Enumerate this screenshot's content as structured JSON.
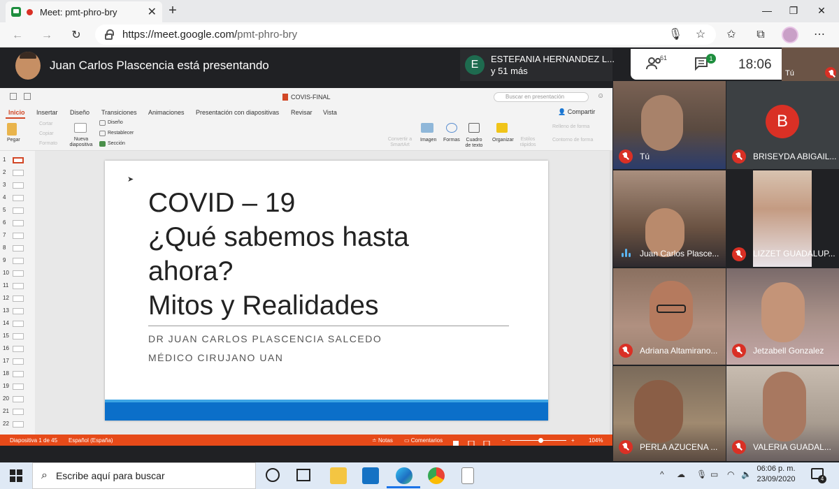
{
  "browser": {
    "tab_title": "Meet: pmt-phro-bry",
    "url_host": "https://meet.google.com/",
    "url_path": "pmt-phro-bry"
  },
  "meet": {
    "presenter_text": "Juan Carlos Plascencia está presentando",
    "pinned_name": "ESTEFANIA HERNANDEZ L...",
    "pinned_initial": "E",
    "pinned_more": "y 51 más",
    "participant_count": "61",
    "chat_badge": "1",
    "time": "18:06",
    "self_top_label": "Tú"
  },
  "ppt": {
    "doc_name": "COVIS-FINAL",
    "search_placeholder": "Buscar en presentación",
    "tabs": [
      "Inicio",
      "Insertar",
      "Diseño",
      "Transiciones",
      "Animaciones",
      "Presentación con diapositivas",
      "Revisar",
      "Vista"
    ],
    "share": "Compartir",
    "ribbon": {
      "paste": "Pegar",
      "cut": "Cortar",
      "copy": "Copiar",
      "format": "Formato",
      "new_slide": "Nueva diapositiva",
      "design": "Diseño",
      "reset": "Restablecer",
      "section": "Sección",
      "convert": "Convertir a SmartArt",
      "image": "Imagen",
      "shapes": "Formas",
      "textbox": "Cuadro de texto",
      "arrange": "Organizar",
      "quick_styles": "Estilos rápidos",
      "fill": "Relleno de forma",
      "outline": "Contorno de forma"
    },
    "thumb_numbers": [
      "1",
      "2",
      "3",
      "4",
      "5",
      "6",
      "7",
      "8",
      "9",
      "10",
      "11",
      "12",
      "13",
      "14",
      "15",
      "16",
      "17",
      "18",
      "19",
      "20",
      "21",
      "22"
    ],
    "slide": {
      "title_lines": [
        "COVID – 19",
        "¿Qué sabemos hasta",
        "ahora?",
        "Mitos y Realidades"
      ],
      "subtitle1": "DR JUAN CARLOS PLASCENCIA SALCEDO",
      "subtitle2": "MÉDICO CIRUJANO UAN"
    },
    "status": {
      "slide": "Diapositiva 1 de 45",
      "lang": "Español (España)",
      "notes": "Notas",
      "comments": "Comentarios",
      "zoom": "104%"
    }
  },
  "participants": [
    {
      "name": "Tú",
      "muted": true
    },
    {
      "name": "BRISEYDA ABIGAIL...",
      "muted": true,
      "initial": "B"
    },
    {
      "name": "Juan Carlos Plasce...",
      "muted": false
    },
    {
      "name": "LIZZET GUADALUP...",
      "muted": true
    },
    {
      "name": "Adriana Altamirano...",
      "muted": true
    },
    {
      "name": "Jetzabell Gonzalez",
      "muted": true
    },
    {
      "name": "PERLA AZUCENA ...",
      "muted": true
    },
    {
      "name": "VALERIA GUADAL...",
      "muted": true
    }
  ],
  "taskbar": {
    "search_placeholder": "Escribe aquí para buscar",
    "time": "06:06 p. m.",
    "date": "23/09/2020",
    "notif_count": "4"
  },
  "colors": {
    "meet_bg": "#202124",
    "ppt_orange": "#e64a19",
    "slide_blue": "#0b6fc9",
    "mute_red": "#d93025"
  }
}
